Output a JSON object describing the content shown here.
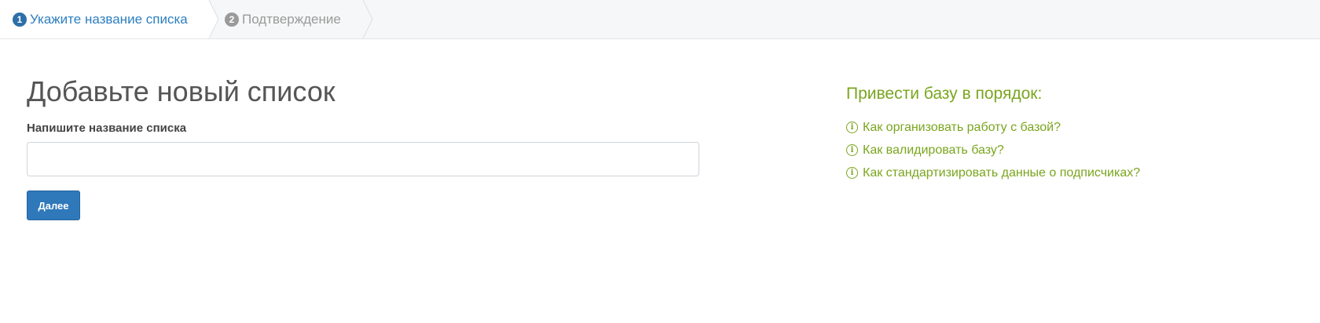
{
  "wizard": {
    "steps": [
      {
        "number": "1",
        "label": "Укажите название списка"
      },
      {
        "number": "2",
        "label": "Подтверждение"
      }
    ]
  },
  "form": {
    "title": "Добавьте новый список",
    "field_label": "Напишите название списка",
    "input_value": "",
    "next_label": "Далее"
  },
  "help": {
    "title": "Привести базу в порядок:",
    "links": [
      "Как организовать работу с базой?",
      "Как валидировать базу?",
      "Как стандартизировать данные о подписчиках?"
    ]
  },
  "colors": {
    "accent": "#2f78ba",
    "help_green": "#7aa51e",
    "step_inactive": "#9a9a9a"
  }
}
